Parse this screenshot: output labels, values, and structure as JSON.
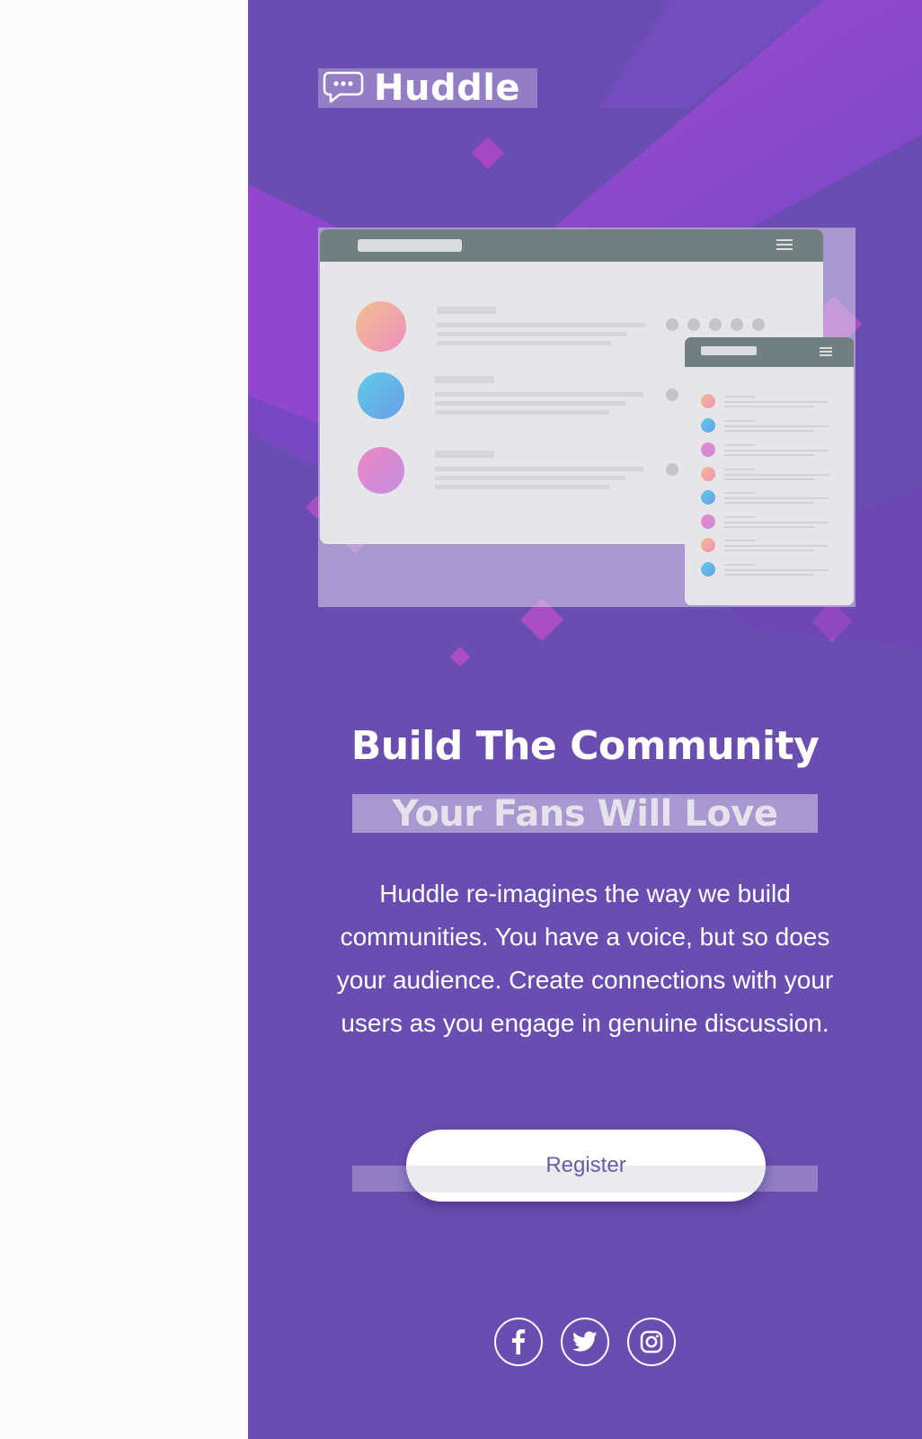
{
  "brand": {
    "name": "Huddle"
  },
  "hero": {
    "headline": "Build The Community",
    "subheadline": "Your Fans Will Love",
    "description": "Huddle re-imagines the way we build communities. You have a voice, but so does your audience. Create connections with your users as you engage in genuine discussion."
  },
  "cta": {
    "register_label": "Register"
  },
  "social": [
    {
      "icon": "facebook-icon"
    },
    {
      "icon": "twitter-icon"
    },
    {
      "icon": "instagram-icon"
    }
  ],
  "colors": {
    "background": "#6a4db0",
    "accent_magenta": "#9a4ccf",
    "page_left": "#fcfcfc"
  }
}
